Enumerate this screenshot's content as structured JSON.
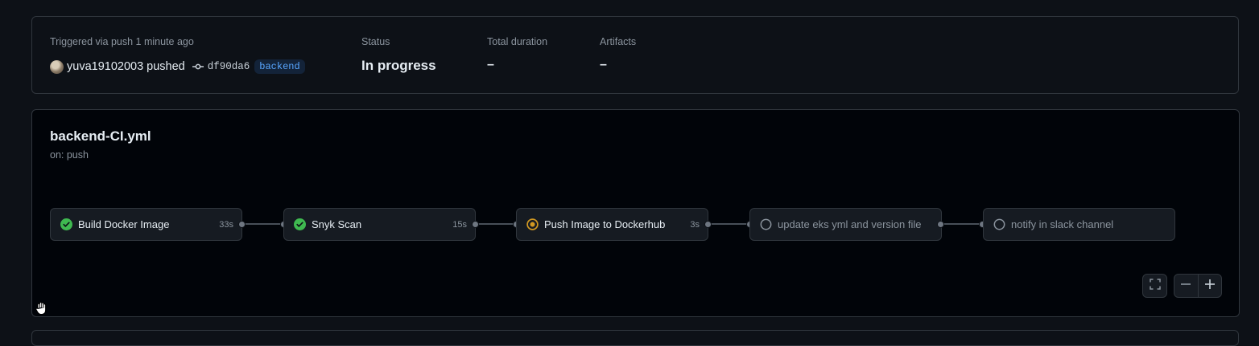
{
  "summary": {
    "trigger_text": "Triggered via push 1 minute ago",
    "actor": "yuva19102003 pushed",
    "commit_sha": "df90da6",
    "branch": "backend",
    "status_label": "Status",
    "status_value": "In progress",
    "duration_label": "Total duration",
    "duration_value": "–",
    "artifacts_label": "Artifacts",
    "artifacts_value": "–"
  },
  "workflow": {
    "file_name": "backend-CI.yml",
    "trigger": "on: push",
    "jobs": [
      {
        "name": "Build Docker Image",
        "duration": "33s",
        "status": "success",
        "status_icon": "check-circle-icon"
      },
      {
        "name": "Snyk Scan",
        "duration": "15s",
        "status": "success",
        "status_icon": "check-circle-icon"
      },
      {
        "name": "Push Image to Dockerhub",
        "duration": "3s",
        "status": "in_progress",
        "status_icon": "in-progress-icon"
      },
      {
        "name": "update eks yml and version file",
        "duration": "",
        "status": "queued",
        "status_icon": "empty-circle-icon"
      },
      {
        "name": "notify in slack channel",
        "duration": "",
        "status": "queued",
        "status_icon": "empty-circle-icon"
      }
    ]
  },
  "controls": {
    "fullscreen_icon": "fullscreen-icon",
    "zoom_out_icon": "minus-icon",
    "zoom_in_icon": "plus-icon"
  },
  "colors": {
    "success": "#3fb950",
    "in_progress": "#d29922",
    "queued": "#8b949e",
    "link": "#58a6ff"
  }
}
